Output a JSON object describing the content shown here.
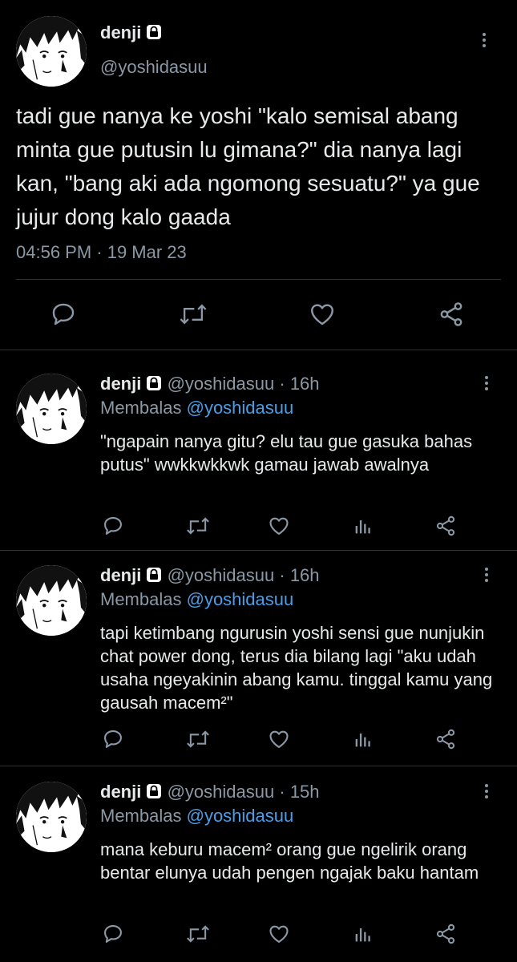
{
  "main_tweet": {
    "display_name": "denji",
    "handle": "@yoshidasuu",
    "text": "tadi gue nanya ke yoshi \"kalo semisal abang minta gue putusin lu gimana?\" dia nanya lagi kan, \"bang aki ada ngomong sesuatu?\" ya gue jujur dong kalo gaada",
    "timestamp": "04:56 PM · 19 Mar 23",
    "icons": [
      "reply-icon",
      "retweet-icon",
      "like-icon",
      "share-icon"
    ]
  },
  "replies": [
    {
      "display_name": "denji",
      "handle": "@yoshidasuu",
      "separator": "·",
      "time": "16h",
      "replying_prefix": "Membalas",
      "replying_to": "@yoshidasuu",
      "text": "\"ngapain nanya gitu? elu tau gue gasuka bahas putus\" wwkkwkkwk gamau jawab awalnya"
    },
    {
      "display_name": "denji",
      "handle": "@yoshidasuu",
      "separator": "·",
      "time": "16h",
      "replying_prefix": "Membalas",
      "replying_to": "@yoshidasuu",
      "text": "tapi ketimbang ngurusin yoshi sensi gue nunjukin chat power dong, terus dia bilang lagi \"aku udah usaha ngeyakinin abang kamu. tinggal kamu yang gausah macem²\""
    },
    {
      "display_name": "denji",
      "handle": "@yoshidasuu",
      "separator": "·",
      "time": "15h",
      "replying_prefix": "Membalas",
      "replying_to": "@yoshidasuu",
      "text": "mana keburu macem² orang gue ngelirik orang bentar elunya udah pengen ngajak baku hantam"
    }
  ],
  "colors": {
    "background": "#000000",
    "text": "#e7e9ea",
    "muted": "#8b98a5",
    "link": "#4a9ee8",
    "divider": "#2f3336"
  }
}
